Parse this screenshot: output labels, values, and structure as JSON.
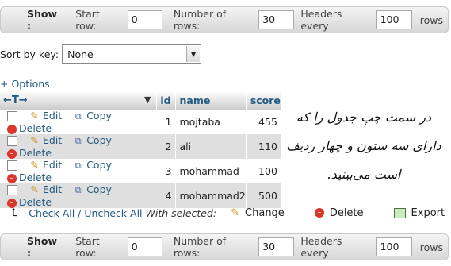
{
  "nav": {
    "show_label": "Show :",
    "start_row_label": "Start row:",
    "start_row_value": "0",
    "rows_label": "Number of rows:",
    "rows_value": "30",
    "headers_label": "Headers every",
    "headers_value": "100",
    "rows_suffix": "rows"
  },
  "sort": {
    "label": "Sort by key:",
    "value": "None"
  },
  "options_label": "+ Options",
  "table": {
    "arrows": "←T→",
    "headers": [
      "id",
      "name",
      "score"
    ],
    "actions": {
      "edit": "Edit",
      "copy": "Copy",
      "delete": "Delete"
    },
    "rows": [
      {
        "id": "1",
        "name": "mojtaba",
        "score": "455"
      },
      {
        "id": "2",
        "name": "ali",
        "score": "110"
      },
      {
        "id": "3",
        "name": "mohammad",
        "score": "100"
      },
      {
        "id": "4",
        "name": "mohammad2",
        "score": "500"
      }
    ]
  },
  "note": {
    "line1": "در سمت چپ جدول را که",
    "line2": "دارای سه ستون و چهار ردیف",
    "line3": "است می‌بینید."
  },
  "bulk": {
    "check_all": "Check All",
    "separator": " / ",
    "uncheck_all": "Uncheck All",
    "with_selected": "With selected:",
    "change": "Change",
    "delete": "Delete",
    "export": "Export"
  }
}
